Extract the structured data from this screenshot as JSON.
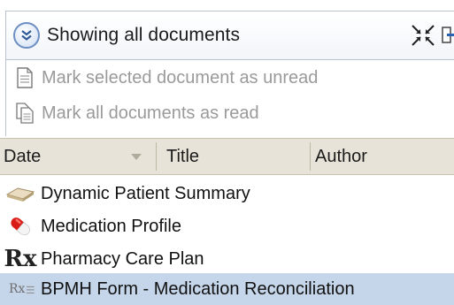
{
  "header": {
    "filter_label": "Showing all documents",
    "filter_icon": "double-chevron-down-icon",
    "collapse_icon": "collapse-arrows-icon",
    "exit_icon": "exit-icon"
  },
  "actions": [
    {
      "label": "Mark selected document as unread",
      "icon": "document-icon"
    },
    {
      "label": "Mark all documents as read",
      "icon": "documents-icon"
    }
  ],
  "columns": {
    "date": "Date",
    "title": "Title",
    "author": "Author",
    "sorted_by": "date"
  },
  "documents": [
    {
      "title": "Dynamic Patient Summary",
      "icon": "summary-icon",
      "selected": false
    },
    {
      "title": "Medication Profile",
      "icon": "pill-icon",
      "selected": false
    },
    {
      "title": "Pharmacy Care Plan",
      "icon": "rx-icon",
      "icon_text": "Rx",
      "selected": false
    },
    {
      "title": "BPMH Form - Medication Reconciliation",
      "icon": "rx-form-icon",
      "icon_text": "Rx",
      "selected": true
    }
  ],
  "colors": {
    "selected_row": "#c6d6ea",
    "column_header_bg": "#e7e3d8",
    "disabled_text": "#9a9a9a"
  }
}
